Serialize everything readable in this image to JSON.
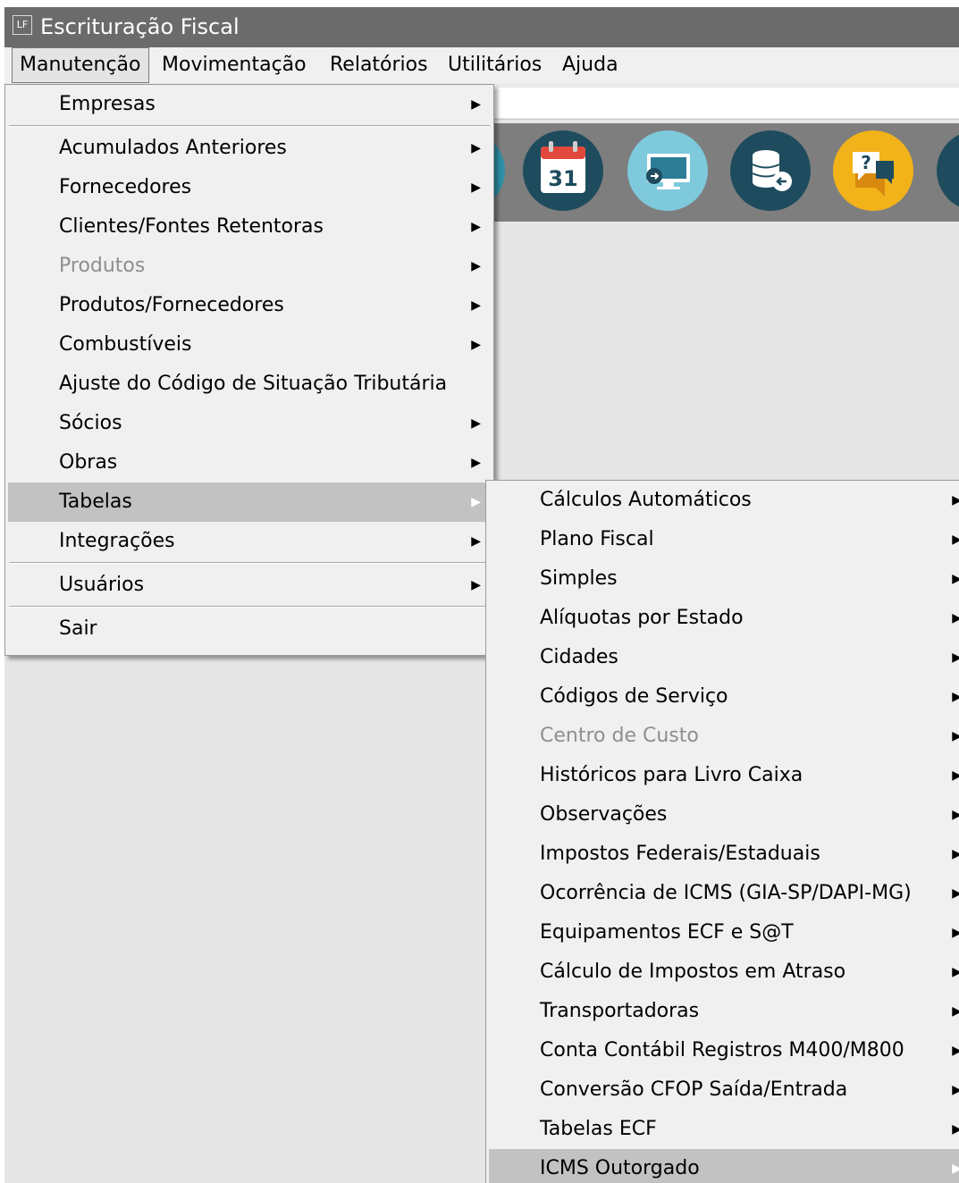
{
  "window": {
    "title": "Escrituração Fiscal",
    "app_icon_label": "LF"
  },
  "menubar": {
    "items": [
      {
        "label": "Manutenção"
      },
      {
        "label": "Movimentação"
      },
      {
        "label": "Relatórios"
      },
      {
        "label": "Utilitários"
      },
      {
        "label": "Ajuda"
      }
    ]
  },
  "toolbar": {
    "icons": [
      {
        "name": "calendar-icon",
        "text": "31",
        "color": "#1e4c5e"
      },
      {
        "name": "monitor-icon",
        "color": "#7ec9dc"
      },
      {
        "name": "database-icon",
        "color": "#1e4c5e"
      },
      {
        "name": "help-chat-icon",
        "text": "?",
        "color": "#f2b21a"
      }
    ]
  },
  "main_menu": {
    "items": [
      {
        "label": "Empresas",
        "submenu": true
      },
      {
        "label": "Acumulados Anteriores",
        "submenu": true
      },
      {
        "label": "Fornecedores",
        "submenu": true
      },
      {
        "label": "Clientes/Fontes Retentoras",
        "submenu": true
      },
      {
        "label": "Produtos",
        "submenu": true,
        "disabled": true
      },
      {
        "label": "Produtos/Fornecedores",
        "submenu": true
      },
      {
        "label": "Combustíveis",
        "submenu": true
      },
      {
        "label": "Ajuste do Código de Situação Tributária",
        "submenu": false
      },
      {
        "label": "Sócios",
        "submenu": true
      },
      {
        "label": "Obras",
        "submenu": true
      },
      {
        "label": "Tabelas",
        "submenu": true,
        "highlighted": true
      },
      {
        "label": "Integrações",
        "submenu": true
      },
      {
        "label": "Usuários",
        "submenu": true
      },
      {
        "label": "Sair",
        "submenu": false
      }
    ]
  },
  "tabelas_submenu": {
    "items": [
      {
        "label": "Cálculos Automáticos"
      },
      {
        "label": "Plano Fiscal"
      },
      {
        "label": "Simples"
      },
      {
        "label": "Alíquotas por Estado"
      },
      {
        "label": "Cidades"
      },
      {
        "label": "Códigos de Serviço"
      },
      {
        "label": "Centro de Custo",
        "disabled": true
      },
      {
        "label": "Históricos para Livro Caixa"
      },
      {
        "label": "Observações"
      },
      {
        "label": "Impostos Federais/Estaduais"
      },
      {
        "label": "Ocorrência de ICMS (GIA-SP/DAPI-MG)"
      },
      {
        "label": "Equipamentos ECF e S@T"
      },
      {
        "label": "Cálculo de Impostos em Atraso"
      },
      {
        "label": "Transportadoras"
      },
      {
        "label": "Conta Contábil Registros M400/M800"
      },
      {
        "label": "Conversão CFOP Saída/Entrada"
      },
      {
        "label": "Tabelas ECF"
      },
      {
        "label": "ICMS Outorgado",
        "highlighted": true
      }
    ]
  },
  "arrow_glyph": "▶"
}
